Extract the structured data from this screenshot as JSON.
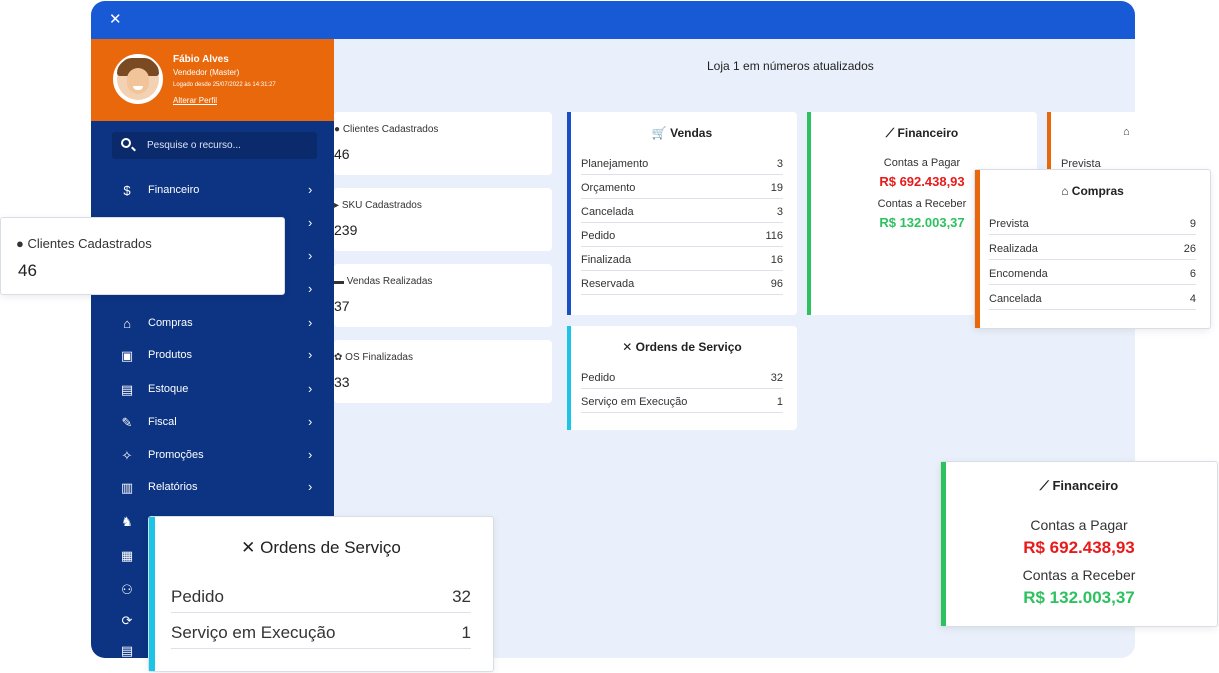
{
  "topbar": {
    "close_icon": "close-icon"
  },
  "profile": {
    "name": "Fábio Alves",
    "role": "Vendedor (Master)",
    "logged_since": "Logado desde 25/07/2022 às 14:31:27",
    "edit_link": "Alterar Perfil"
  },
  "search": {
    "placeholder": "Pesquise o recurso..."
  },
  "nav": {
    "items": [
      {
        "label": "Financeiro",
        "icon": "dollar-icon"
      },
      {
        "label": "Compras",
        "icon": "bag-icon"
      },
      {
        "label": "Produtos",
        "icon": "box-icon"
      },
      {
        "label": "Estoque",
        "icon": "warehouse-icon"
      },
      {
        "label": "Fiscal",
        "icon": "document-icon"
      },
      {
        "label": "Promoções",
        "icon": "megaphone-icon"
      },
      {
        "label": "Relatórios",
        "icon": "bars-icon"
      }
    ]
  },
  "main": {
    "title": "Loja 1 em números atualizados"
  },
  "stats": [
    {
      "label": "Clientes Cadastrados",
      "value": "46"
    },
    {
      "label": "SKU Cadastrados",
      "value": "239"
    },
    {
      "label": "Vendas Realizadas",
      "value": "37"
    },
    {
      "label": "OS Finalizadas",
      "value": "33"
    }
  ],
  "vendas": {
    "title": "Vendas",
    "rows": [
      {
        "k": "Planejamento",
        "v": "3"
      },
      {
        "k": "Orçamento",
        "v": "19"
      },
      {
        "k": "Cancelada",
        "v": "3"
      },
      {
        "k": "Pedido",
        "v": "116"
      },
      {
        "k": "Finalizada",
        "v": "16"
      },
      {
        "k": "Reservada",
        "v": "96"
      }
    ]
  },
  "ordens": {
    "title": "Ordens de Serviço",
    "rows": [
      {
        "k": "Pedido",
        "v": "32"
      },
      {
        "k": "Serviço em Execução",
        "v": "1"
      }
    ]
  },
  "financeiro": {
    "title": "Financeiro",
    "pagar_label": "Contas a Pagar",
    "pagar_value": "R$ 692.438,93",
    "receber_label": "Contas a Receber",
    "receber_value": "R$ 132.003,37"
  },
  "compras": {
    "title": "Compras",
    "partial_row": "Prevista",
    "rows": [
      {
        "k": "Prevista",
        "v": "9"
      },
      {
        "k": "Realizada",
        "v": "26"
      },
      {
        "k": "Encomenda",
        "v": "6"
      },
      {
        "k": "Cancelada",
        "v": "4"
      }
    ]
  },
  "colors": {
    "topbar": "#1859d6",
    "sidebar": "#0c3483",
    "profile": "#e9680b",
    "vendas_accent": "#1b4fc4",
    "financeiro_accent": "#2ec15f",
    "compras_accent": "#e9680b",
    "ordens_accent": "#1cc4e8",
    "red": "#e81a1a",
    "green": "#2ec15f"
  }
}
